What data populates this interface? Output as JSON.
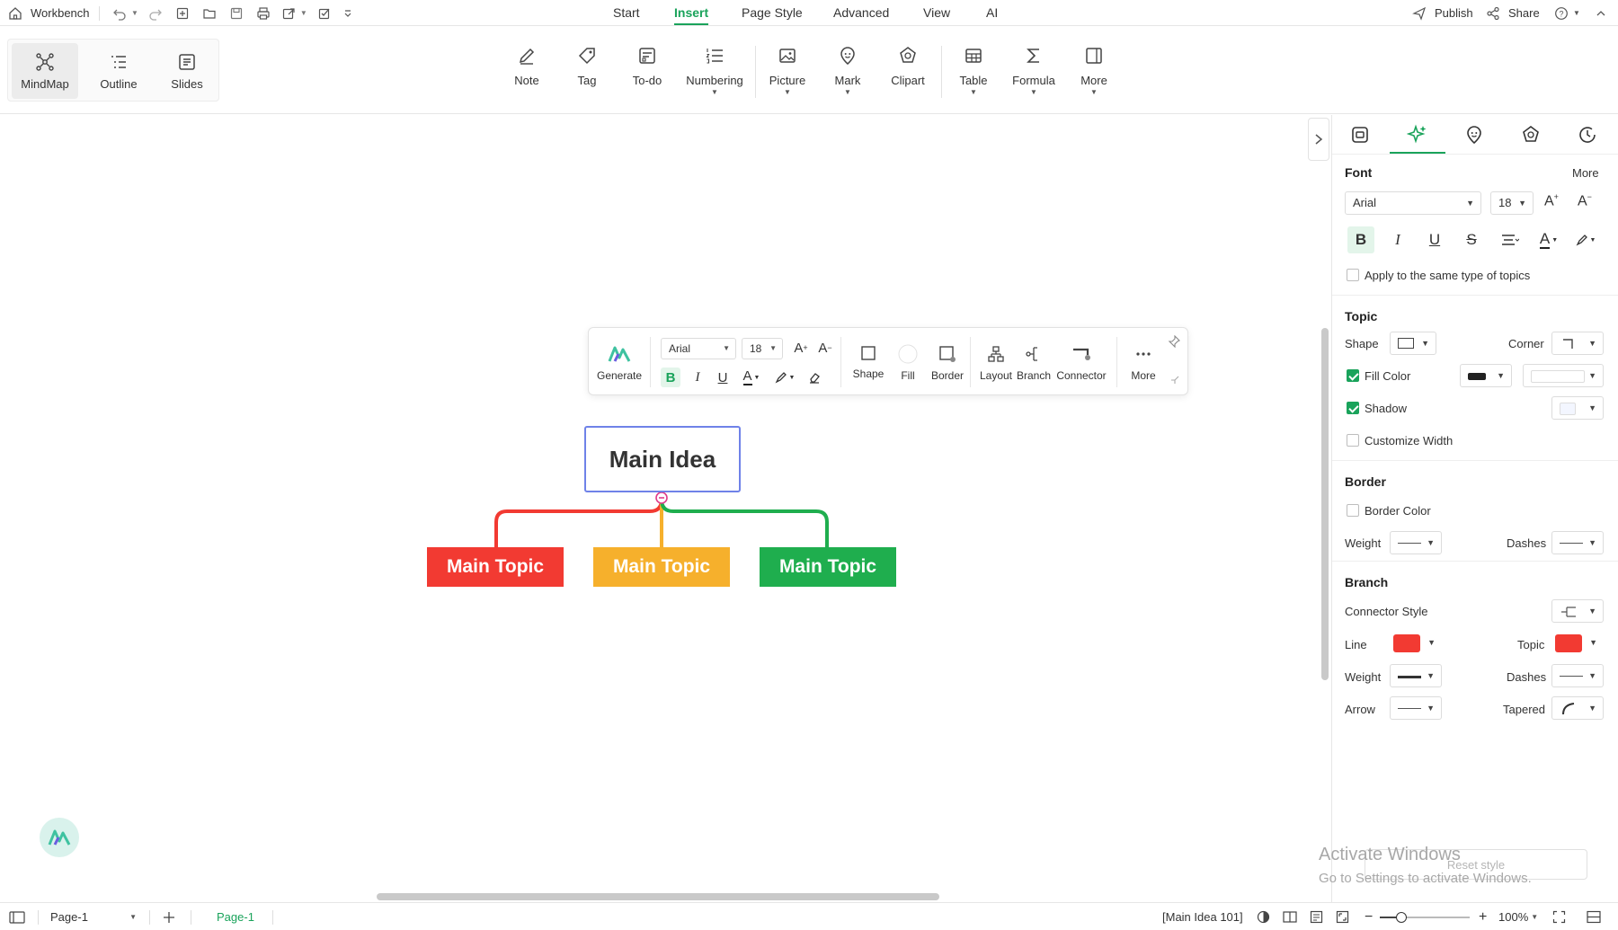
{
  "topbar": {
    "workbench_label": "Workbench",
    "menu_tabs": [
      "Start",
      "Insert",
      "Page Style",
      "Advanced",
      "View",
      "AI"
    ],
    "active_tab": "Insert",
    "publish_label": "Publish",
    "share_label": "Share"
  },
  "ribbon": {
    "views": [
      "MindMap",
      "Outline",
      "Slides"
    ],
    "active_view": "MindMap",
    "buttons": [
      "Note",
      "Tag",
      "To-do",
      "Numbering",
      "Picture",
      "Mark",
      "Clipart",
      "Table",
      "Formula",
      "More"
    ]
  },
  "floating_toolbar": {
    "generate_label": "Generate",
    "font": "Arial",
    "size": "18",
    "buttons": [
      "Shape",
      "Fill",
      "Border",
      "Layout",
      "Branch",
      "Connector",
      "More"
    ]
  },
  "mindmap": {
    "main_idea": "Main Idea",
    "topics": [
      {
        "label": "Main Topic",
        "color": "#f23a32"
      },
      {
        "label": "Main Topic",
        "color": "#f6b02c"
      },
      {
        "label": "Main Topic",
        "color": "#1fae4e"
      }
    ],
    "selection_color": "#6f82e8"
  },
  "panel": {
    "font_section": "Font",
    "more_label": "More",
    "font": "Arial",
    "size": "18",
    "apply_same_label": "Apply to the same type of topics",
    "topic_section": "Topic",
    "shape_label": "Shape",
    "corner_label": "Corner",
    "fill_color_label": "Fill Color",
    "shadow_label": "Shadow",
    "customize_width_label": "Customize Width",
    "border_section": "Border",
    "border_color_label": "Border Color",
    "weight_label": "Weight",
    "dashes_label": "Dashes",
    "branch_section": "Branch",
    "connector_style_label": "Connector Style",
    "line_label": "Line",
    "topic_label": "Topic",
    "arrow_label": "Arrow",
    "tapered_label": "Tapered",
    "reset_label": "Reset style",
    "line_color": "#f23a32",
    "topic_color": "#f23a32",
    "checkboxes": {
      "apply_same": false,
      "fill_color": true,
      "shadow": true,
      "customize_width": false,
      "border_color": false
    }
  },
  "watermark": {
    "title": "Activate Windows",
    "subtitle": "Go to Settings to activate Windows."
  },
  "statusbar": {
    "page_select": "Page-1",
    "page_tab": "Page-1",
    "selection_info": "[Main Idea 101]",
    "zoom": "100%"
  },
  "accent_color": "#1aa35b"
}
